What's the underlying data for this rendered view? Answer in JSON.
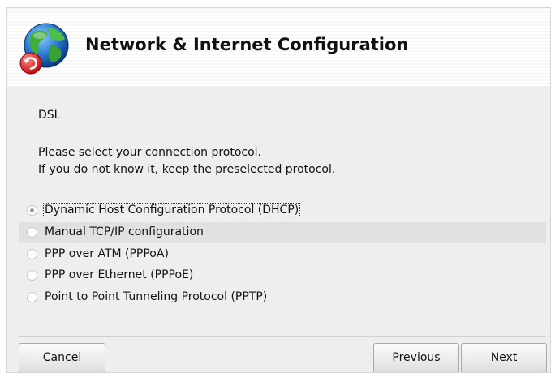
{
  "header": {
    "title": "Network & Internet Configuration",
    "icon": "globe-network-icon"
  },
  "content": {
    "connection_type": "DSL",
    "instruction_line1": "Please select your connection protocol.",
    "instruction_line2": "If you do not know it, keep the preselected protocol."
  },
  "protocols": [
    {
      "label": "Dynamic Host Configuration Protocol (DHCP)",
      "selected": true
    },
    {
      "label": "Manual TCP/IP configuration",
      "selected": false
    },
    {
      "label": "PPP over ATM (PPPoA)",
      "selected": false
    },
    {
      "label": "PPP over Ethernet (PPPoE)",
      "selected": false
    },
    {
      "label": "Point to Point Tunneling Protocol (PPTP)",
      "selected": false
    }
  ],
  "buttons": {
    "cancel": "Cancel",
    "previous": "Previous",
    "next": "Next"
  },
  "colors": {
    "background": "#eeeeee",
    "highlight_row": "#e1e1e1"
  }
}
